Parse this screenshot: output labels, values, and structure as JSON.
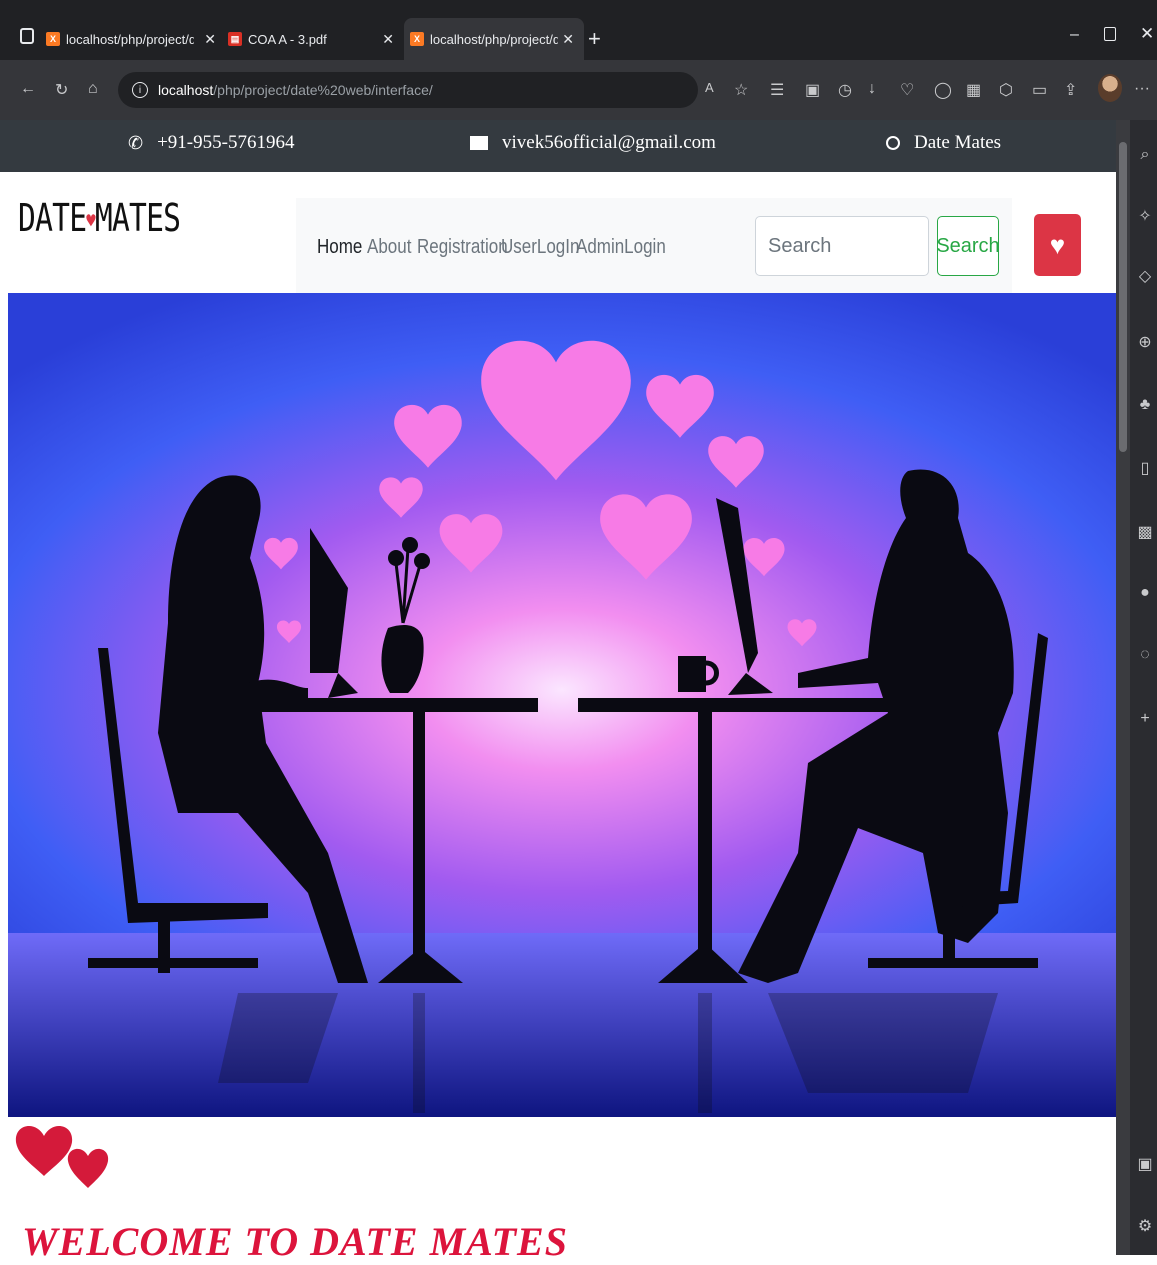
{
  "browser": {
    "tabs": [
      {
        "title": "localhost/php/project/date web/",
        "icon": "xampp-icon"
      },
      {
        "title": "COA A - 3.pdf",
        "icon": "pdf-icon"
      },
      {
        "title": "localhost/php/project/date web/",
        "icon": "xampp-icon",
        "active": true
      }
    ],
    "url_host": "localhost",
    "url_path": "/php/project/date%20web/interface/"
  },
  "topbar": {
    "phone": "+91-955-5761964",
    "email": "vivek56official@gmail.com",
    "site_name": "Date Mates"
  },
  "header": {
    "logo_left": "DATE",
    "logo_right": "MATES",
    "nav": [
      "Home",
      "About",
      "Registration",
      "UserLogIn",
      "AdminLogin"
    ],
    "search_placeholder": "Search",
    "search_button": "Search"
  },
  "colors": {
    "accent_red": "#dc3545",
    "welcome_red": "#dc143c",
    "search_green": "#28a745",
    "topbar_bg": "#343a40"
  },
  "welcome": {
    "title": "WELCOME TO DATE MATES"
  }
}
